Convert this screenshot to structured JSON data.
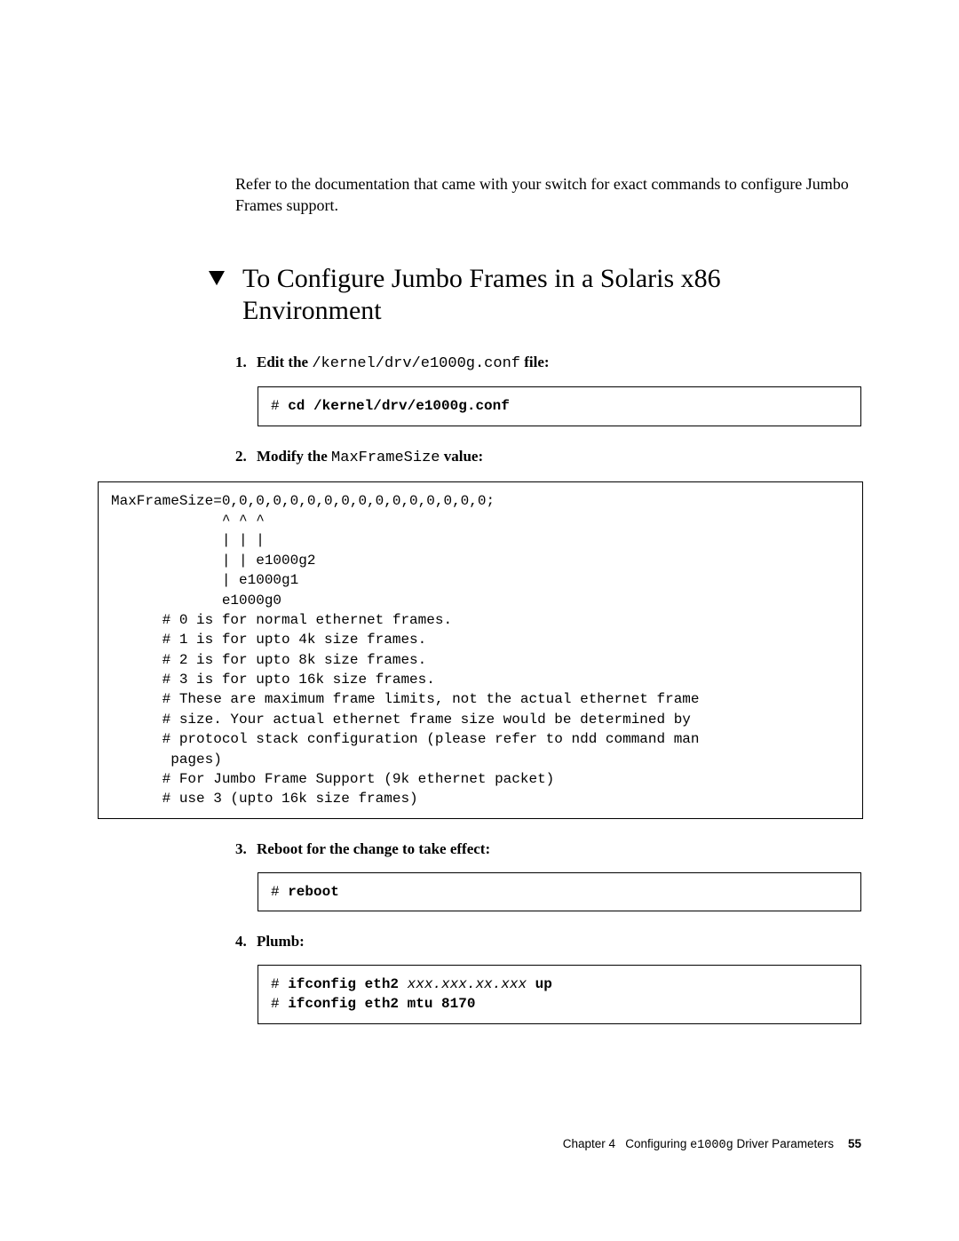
{
  "intro": "Refer to the documentation that came with your switch for exact commands to configure Jumbo Frames support.",
  "heading": "To Configure Jumbo Frames in a Solaris x86 Environment",
  "steps": {
    "s1": {
      "num": "1.",
      "prefix": "Edit the ",
      "path": "/kernel/drv/e1000g.conf",
      "suffix": " file:"
    },
    "s2": {
      "num": "2.",
      "prefix": "Modify the ",
      "token": "MaxFrameSize",
      "suffix": " value:"
    },
    "s3": {
      "num": "3.",
      "text": "Reboot for the change to take effect:"
    },
    "s4": {
      "num": "4.",
      "text": "Plumb:"
    }
  },
  "code": {
    "box1_prompt": "# ",
    "box1_cmd": "cd /kernel/drv/e1000g.conf",
    "box2": "MaxFrameSize=0,0,0,0,0,0,0,0,0,0,0,0,0,0,0,0;\n             ^ ^ ^\n             | | |\n             | | e1000g2\n             | e1000g1\n             e1000g0\n      # 0 is for normal ethernet frames.\n      # 1 is for upto 4k size frames.\n      # 2 is for upto 8k size frames.\n      # 3 is for upto 16k size frames.\n      # These are maximum frame limits, not the actual ethernet frame\n      # size. Your actual ethernet frame size would be determined by\n      # protocol stack configuration (please refer to ndd command man\n       pages)\n      # For Jumbo Frame Support (9k ethernet packet)\n      # use 3 (upto 16k size frames)",
    "box3_prompt": "# ",
    "box3_cmd": "reboot",
    "box4_line1_prompt": "# ",
    "box4_line1_a": "ifconfig eth2 ",
    "box4_line1_i": "xxx.xxx.xx.xxx",
    "box4_line1_b": " up",
    "box4_line2_prompt": "# ",
    "box4_line2_cmd": "ifconfig eth2 mtu 8170"
  },
  "footer": {
    "chapter": "Chapter 4",
    "title_a": "Configuring ",
    "title_mono": "e1000g",
    "title_b": " Driver Parameters",
    "page": "55"
  }
}
